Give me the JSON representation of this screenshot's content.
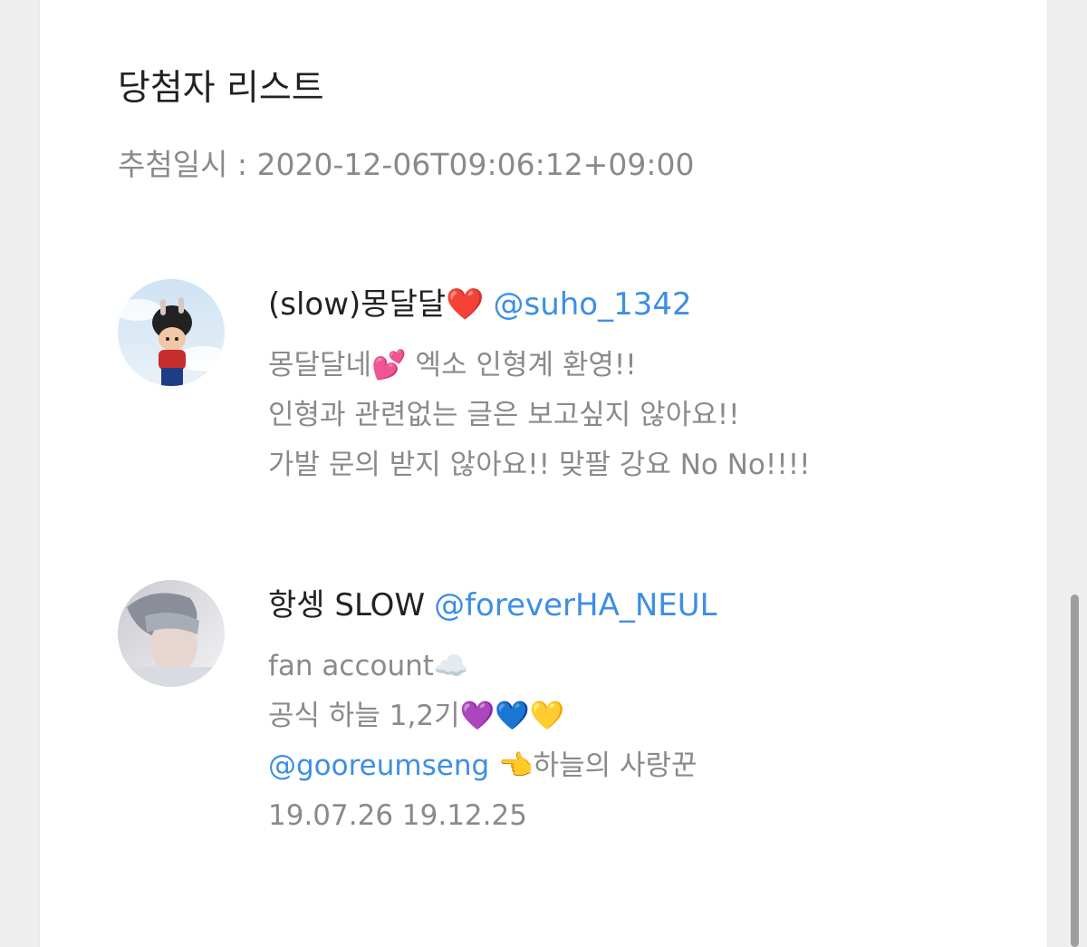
{
  "page": {
    "title": "당첨자 리스트",
    "draw_date": "추첨일시 : 2020-12-06T09:06:12+09:00"
  },
  "winners": [
    {
      "display_name": "(slow)몽달달❤️",
      "handle": "@suho_1342",
      "bio": [
        "몽달달네💕 엑소 인형계 환영!!",
        "인형과 관련없는 글은 보고싶지 않아요!!",
        "가발 문의 받지 않아요!! 맞팔 강요 No No!!!!"
      ]
    },
    {
      "display_name": "항셍 SLOW",
      "handle": "@foreverHA_NEUL",
      "bio": [
        "fan account☁️",
        "공식 하늘 1,2기💜💙💛"
      ],
      "bio_mention": "@gooreumseng",
      "bio_mention_suffix": " 👈하늘의 사랑꾼",
      "bio_dates": "19.07.26 19.12.25"
    }
  ],
  "colors": {
    "link": "#3d8ee5",
    "text_primary": "#222222",
    "text_secondary": "#8a8a8a"
  }
}
